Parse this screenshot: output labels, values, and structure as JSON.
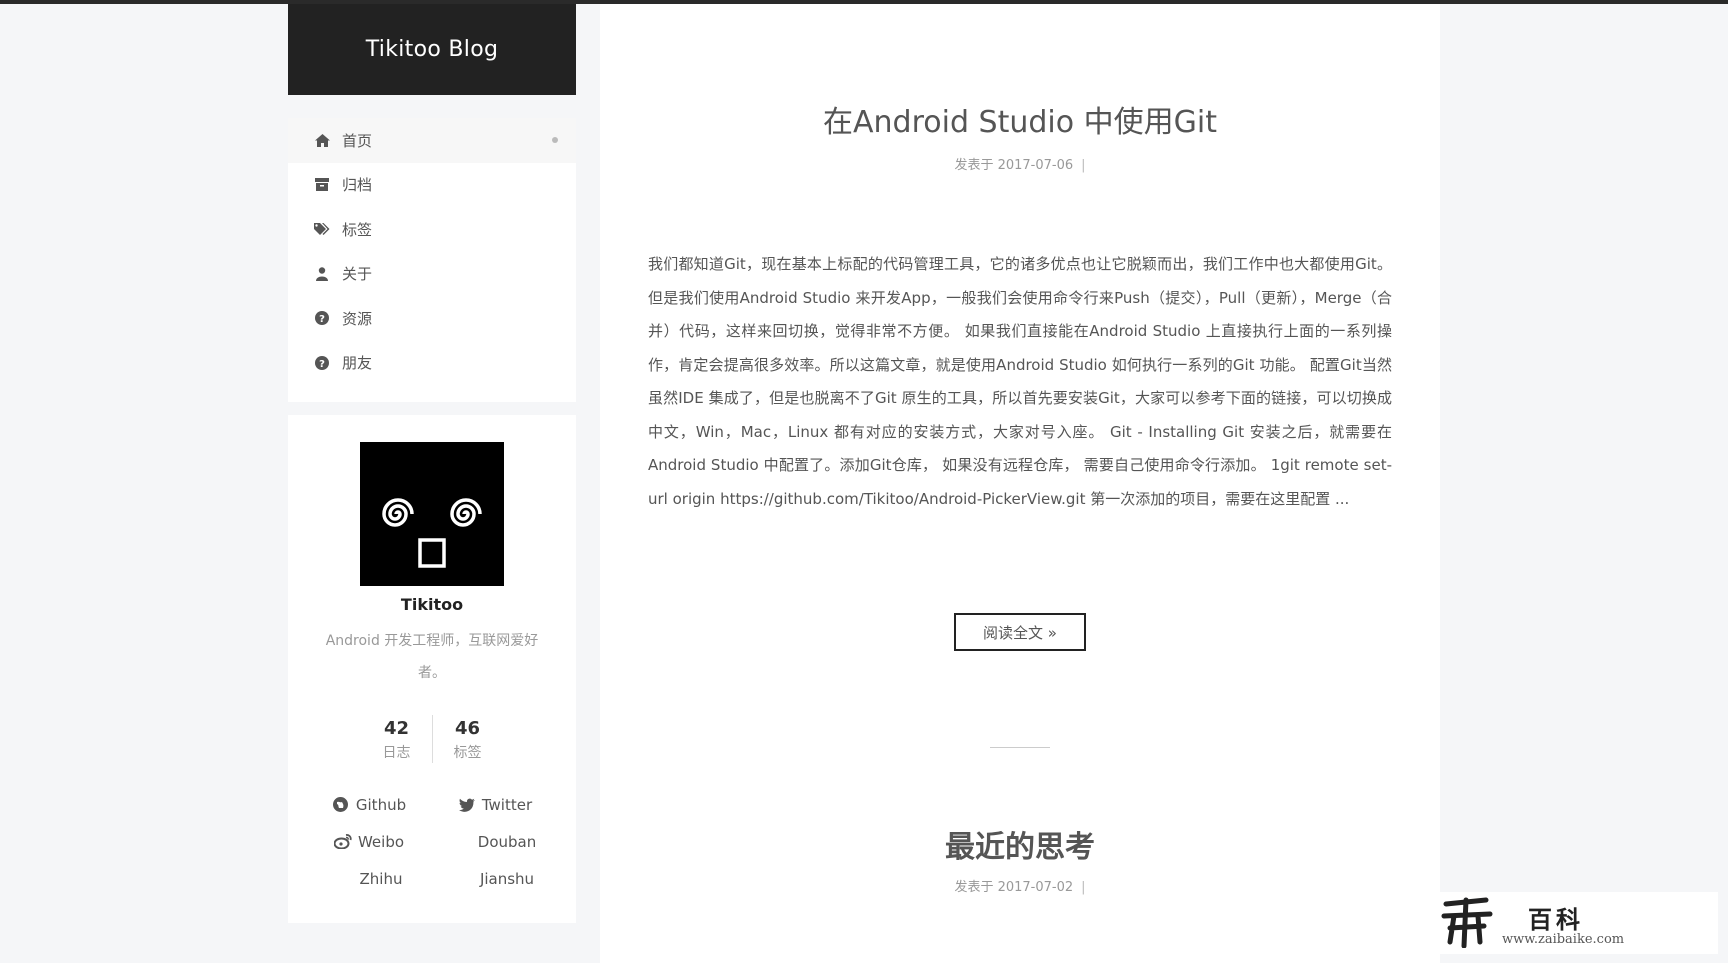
{
  "site": {
    "title": "Tikitoo Blog"
  },
  "menu": {
    "items": [
      {
        "label": "首页",
        "icon": "home-icon",
        "active": true
      },
      {
        "label": "归档",
        "icon": "archive-icon"
      },
      {
        "label": "标签",
        "icon": "tags-icon"
      },
      {
        "label": "关于",
        "icon": "user-icon"
      },
      {
        "label": "资源",
        "icon": "question-icon"
      },
      {
        "label": "朋友",
        "icon": "question-icon"
      }
    ]
  },
  "profile": {
    "name": "Tikitoo",
    "description": "Android 开发工程师，互联网爱好者。",
    "stats": [
      {
        "count": "42",
        "label": "日志"
      },
      {
        "count": "46",
        "label": "标签"
      }
    ],
    "links": [
      {
        "label": "Github",
        "icon": "github-icon"
      },
      {
        "label": "Twitter",
        "icon": "twitter-icon"
      },
      {
        "label": "Weibo",
        "icon": "weibo-icon"
      },
      {
        "label": "Douban",
        "icon": ""
      },
      {
        "label": "Zhihu",
        "icon": ""
      },
      {
        "label": "Jianshu",
        "icon": ""
      }
    ]
  },
  "posts": [
    {
      "title": "在Android Studio 中使用Git",
      "meta": "发表于 2017-07-06",
      "separator": "|",
      "excerpt": "我们都知道Git，现在基本上标配的代码管理工具，它的诸多优点也让它脱颖而出，我们工作中也大都使用Git。 但是我们使用Android Studio 来开发App，一般我们会使用命令行来Push（提交），Pull（更新），Merge（合并）代码，这样来回切换，觉得非常不方便。 如果我们直接能在Android Studio 上直接执行上面的一系列操作，肯定会提高很多效率。所以这篇文章，就是使用Android Studio 如何执行一系列的Git 功能。 配置Git当然虽然IDE 集成了，但是也脱离不了Git 原生的工具，所以首先要安装Git，大家可以参考下面的链接，可以切换成中文，Win，Mac，Linux 都有对应的安装方式，大家对号入座。 Git - Installing Git 安装之后，就需要在Android Studio 中配置了。添加Git仓库， 如果没有远程仓库， 需要自己使用命令行添加。 1git remote set-url origin https://github.com/Tikitoo/Android-PickerView.git 第一次添加的项目，需要在这里配置 ...",
      "read_more": "阅读全文 »"
    },
    {
      "title": "最近的思考",
      "meta": "发表于 2017-07-02",
      "separator": "|"
    }
  ],
  "watermark": {
    "cn": "百科",
    "url": "www.zaibaike.com"
  }
}
